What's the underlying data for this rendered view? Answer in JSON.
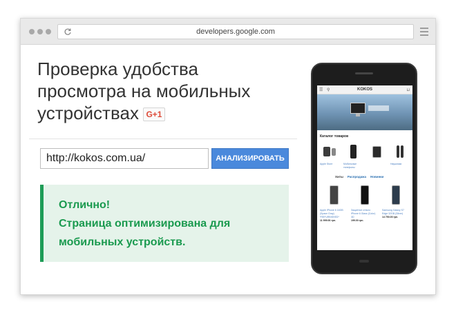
{
  "browser": {
    "url": "developers.google.com"
  },
  "page": {
    "heading": "Проверка удобства просмотра на мобильных устройствах",
    "gplus_label": "G+1",
    "url_input_value": "http://kokos.com.ua/",
    "analyze_button": "АНАЛИЗИРОВАТЬ",
    "result": {
      "line1": "Отлично!",
      "line2": "Страница оптимизирована для",
      "line3": "мобильных устройств."
    },
    "colors": {
      "accent_button": "#4a89dc",
      "success_text": "#1a9a4f",
      "success_bg": "#e5f3ea"
    }
  },
  "phone_preview": {
    "site_logo": "KOKOS",
    "catalog_title": "Каталог товаров",
    "catalog_items": [
      {
        "label": "Apple Store"
      },
      {
        "label": "Мобильные телефоны"
      },
      {
        "label": ""
      },
      {
        "label": "Наушники"
      }
    ],
    "tabs": [
      "Хиты",
      "Распродажа",
      "Новинки"
    ],
    "products": [
      {
        "name": "Apple iPhone 6 16GB (Space Gray) *REFURBISHED*",
        "price": "11 999.00 грн."
      },
      {
        "name": "Защитное стекло iPhone 6 Glass (Color) 3D",
        "price": "199.00 грн."
      },
      {
        "name": "Samsung Galaxy S7 Edge 32GB (Silver)",
        "price": "14 750.00 грн."
      }
    ]
  }
}
